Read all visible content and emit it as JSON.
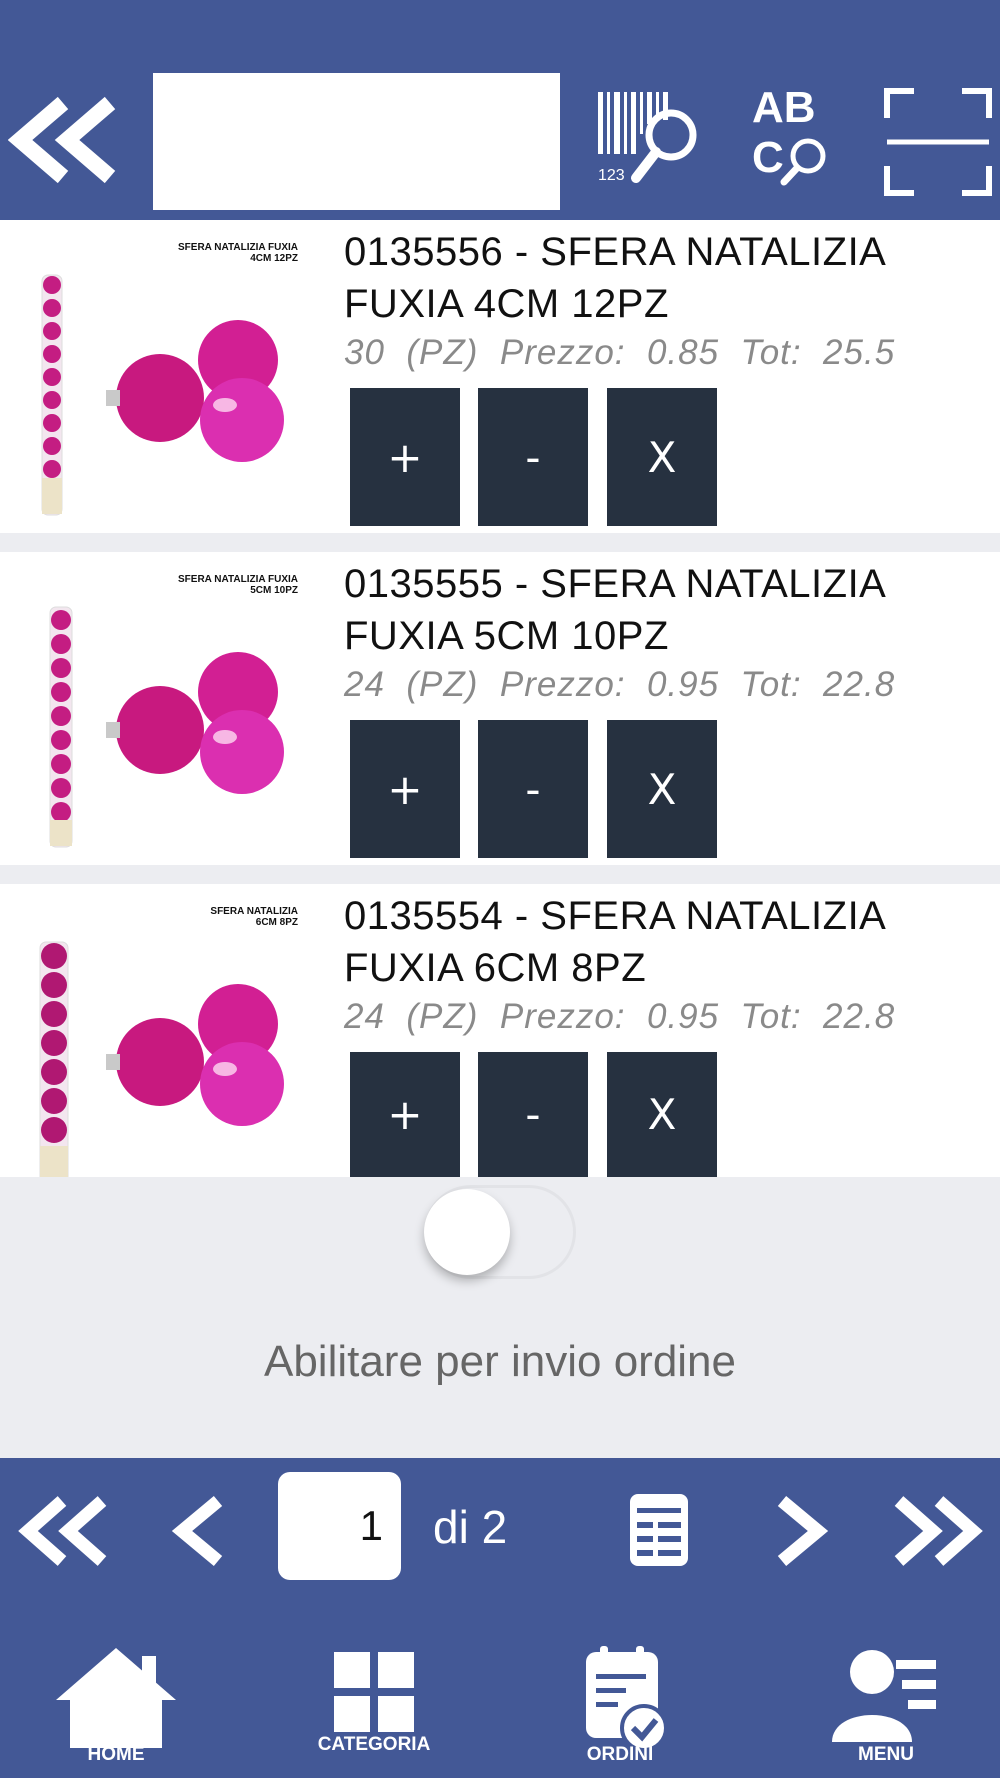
{
  "header": {
    "search_value": "",
    "search_placeholder": ""
  },
  "products": [
    {
      "code": "0135556",
      "title": "0135556 - SFERA NATALIZIA FUXIA  4CM 12PZ",
      "image_caption_line1": "SFERA NATALIZIA FUXIA",
      "image_caption_line2": "4CM 12PZ",
      "info": "30  (PZ)  Prezzo:  0.85  Tot:  25.5"
    },
    {
      "code": "0135555",
      "title": "0135555 - SFERA NATALIZIA FUXIA  5CM 10PZ",
      "image_caption_line1": "SFERA NATALIZIA FUXIA",
      "image_caption_line2": "5CM 10PZ",
      "info": "24  (PZ)  Prezzo:  0.95  Tot:  22.8"
    },
    {
      "code": "0135554",
      "title": "0135554 - SFERA NATALIZIA FUXIA  6CM 8PZ",
      "image_caption_line1": "SFERA NATALIZIA",
      "image_caption_line2": "6CM 8PZ",
      "info": "24  (PZ)  Prezzo:  0.95  Tot:  22.8"
    }
  ],
  "buttons": {
    "plus": "+",
    "minus": "-",
    "remove": "X"
  },
  "toggle": {
    "label": "Abilitare per invio ordine",
    "enabled": false
  },
  "pager": {
    "page": "1",
    "of_label": "di 2"
  },
  "nav": {
    "home": "HOME",
    "categoria": "CATEGORIA",
    "ordini": "ORDINI",
    "menu": "MENU"
  },
  "colors": {
    "bar": "#435896",
    "button": "#263140",
    "product": "#d61f8f"
  }
}
